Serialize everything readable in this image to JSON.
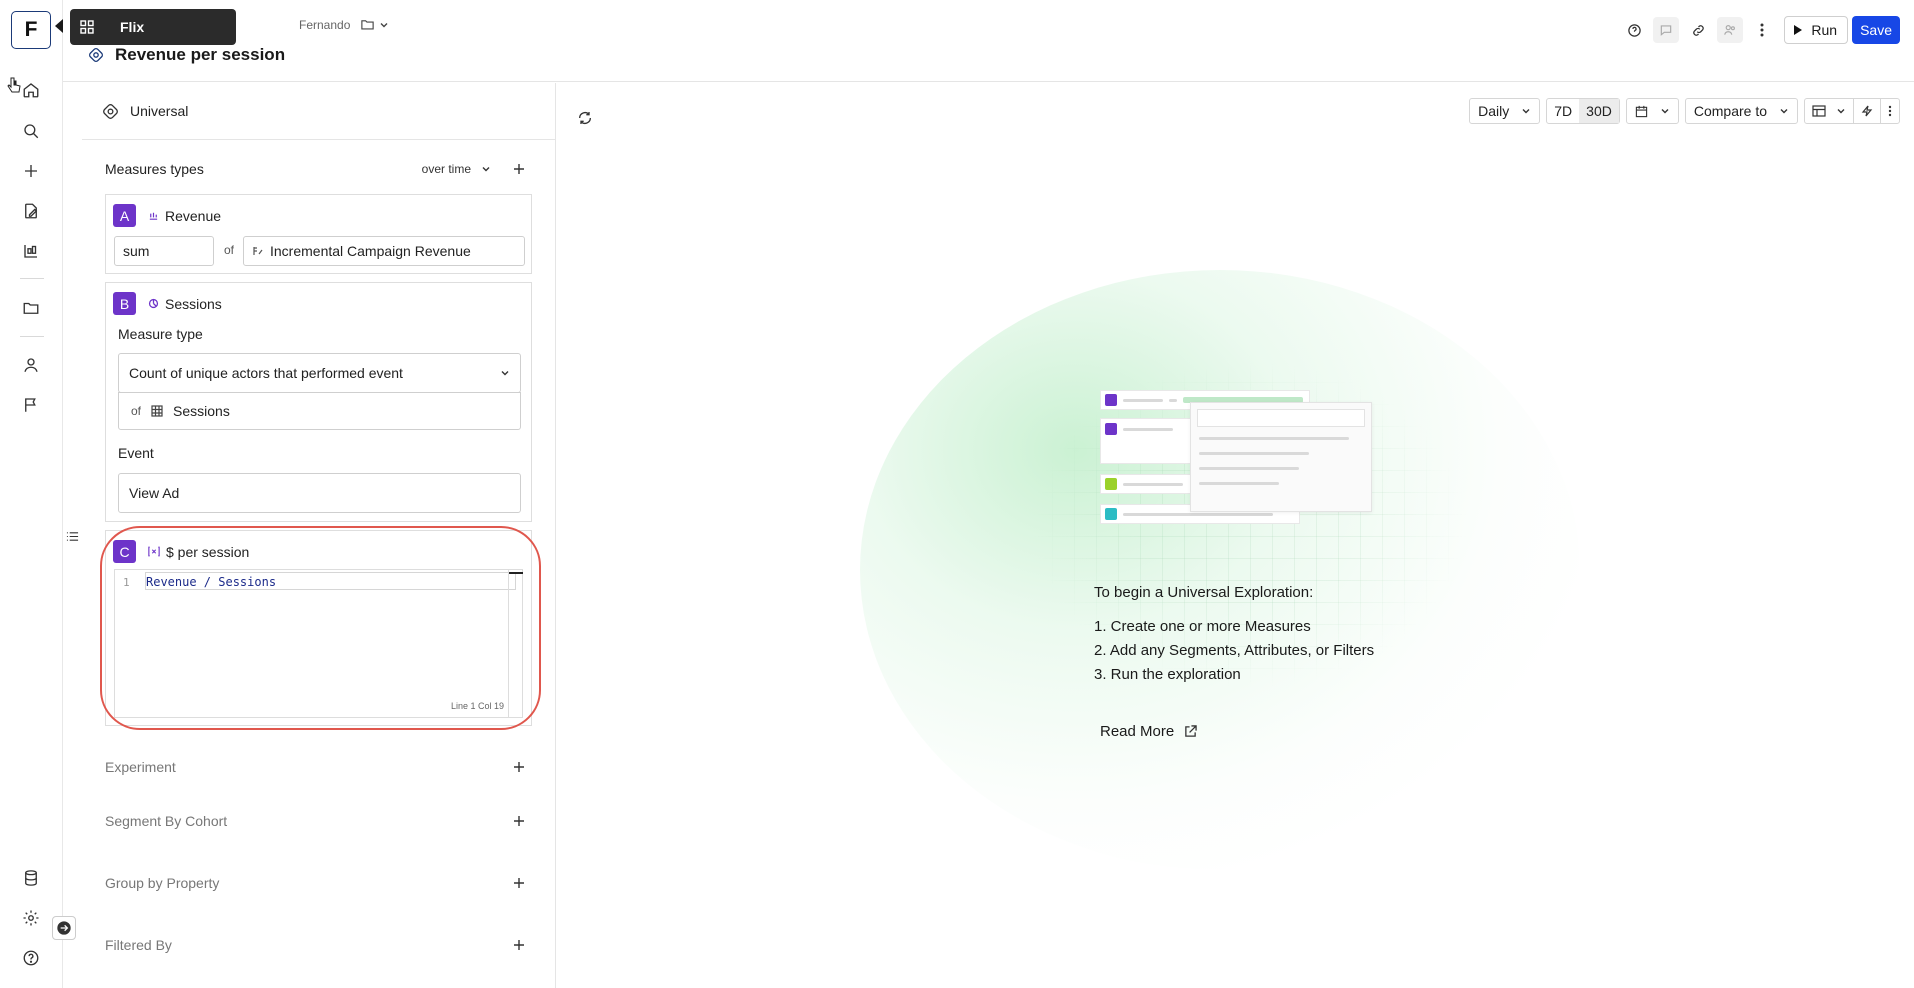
{
  "app": {
    "logo_letter": "F"
  },
  "tooltip": {
    "label": "Flix"
  },
  "breadcrumb": {
    "owner": "Fernando"
  },
  "page": {
    "title": "Revenue per session"
  },
  "header": {
    "run_label": "Run",
    "save_label": "Save"
  },
  "panel": {
    "type_label": "Universal",
    "measures": {
      "title": "Measures types",
      "mode": "over time",
      "items": [
        {
          "letter": "A",
          "name": "Revenue",
          "agg": "sum",
          "of": "of",
          "property": "Incremental Campaign Revenue"
        },
        {
          "letter": "B",
          "name": "Sessions",
          "measure_type_label": "Measure type",
          "measure_type": "Count of unique actors that performed event",
          "of": "of",
          "of_value": "Sessions",
          "event_label": "Event",
          "event": "View Ad"
        },
        {
          "letter": "C",
          "name": "$ per session",
          "line_no": "1",
          "formula": "Revenue / Sessions",
          "cursor": "Line 1 Col 19"
        }
      ]
    },
    "sections": [
      {
        "label": "Experiment"
      },
      {
        "label": "Segment By Cohort"
      },
      {
        "label": "Group by Property"
      },
      {
        "label": "Filtered By"
      }
    ]
  },
  "toolbar": {
    "granularity": "Daily",
    "range_7": "7D",
    "range_30": "30D",
    "active_range": "30D",
    "compare": "Compare to"
  },
  "empty_state": {
    "heading": "To begin a Universal Exploration:",
    "steps": [
      "1. Create one or more Measures",
      "2. Add any Segments, Attributes, or Filters",
      "3. Run the exploration"
    ],
    "read_more": "Read More"
  },
  "colors": {
    "accent": "#1747e6",
    "badge": "#6d34c9",
    "highlight": "#e0574d"
  }
}
